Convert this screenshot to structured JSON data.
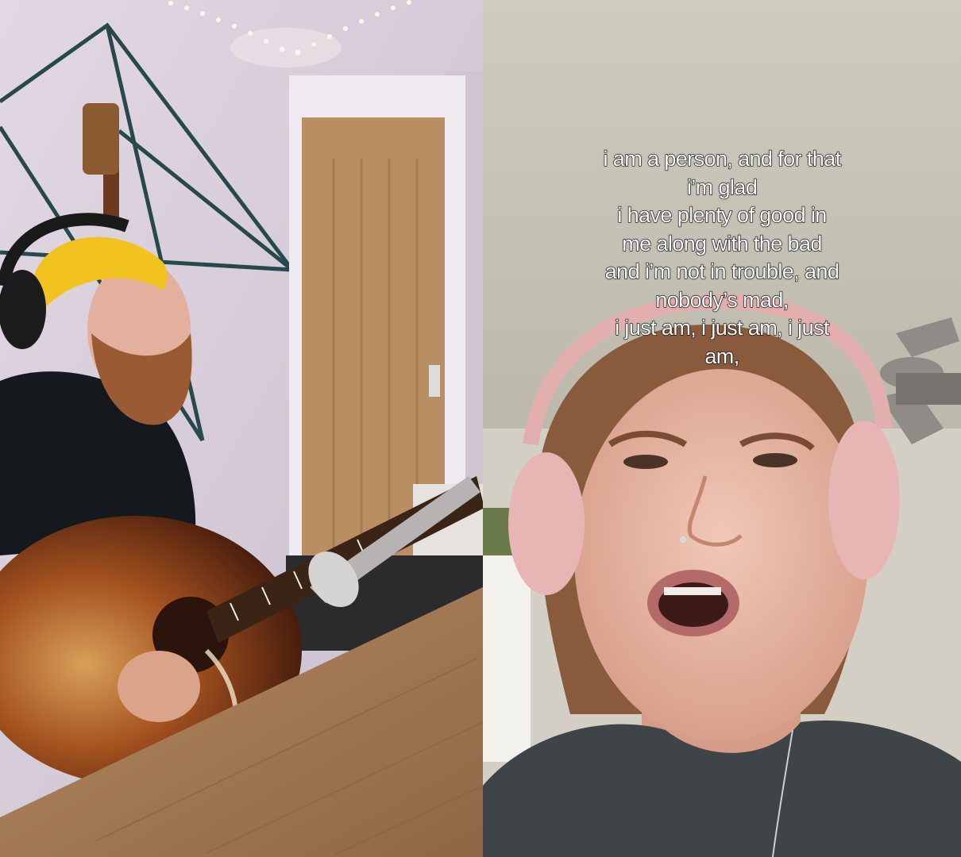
{
  "video_left": {
    "subject": "man-playing-acoustic-guitar",
    "colors": {
      "wall": "#d9cfdc",
      "door": "#b98e62",
      "beanie": "#f2c21e",
      "beard": "#9a5b33",
      "shirt": "#15181d",
      "guitar": "#8a3a1c",
      "desk": "#a07a55",
      "tape": "#27484c"
    }
  },
  "video_right": {
    "subject": "woman-with-pink-headphones-singing",
    "colors": {
      "ceiling": "#c9c6b8",
      "skin": "#e8b8a6",
      "hair": "#8a5a3c",
      "headphones": "#e8b5b5",
      "shirt": "#3f4448",
      "fan": "#8f8c88"
    },
    "caption_lines": [
      "i am a person, and for that",
      "i’m glad",
      "i have plenty of good in",
      "me along with the bad",
      "and i’m not in trouble, and",
      "nobody’s mad,",
      "i just am, i just am, i just",
      "am,"
    ]
  }
}
